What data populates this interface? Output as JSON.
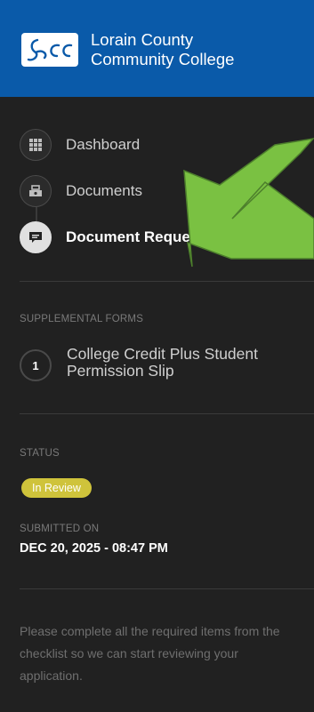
{
  "header": {
    "brand_line1": "Lorain County",
    "brand_line2": "Community College",
    "logo_text": "Lcc"
  },
  "nav": [
    {
      "label": "Dashboard",
      "icon": "grid-icon",
      "active": false
    },
    {
      "label": "Documents",
      "icon": "documents-icon",
      "active": false
    },
    {
      "label": "Document Request",
      "icon": "comment-icon",
      "active": true
    }
  ],
  "supplemental": {
    "title": "SUPPLEMENTAL FORMS",
    "items": [
      {
        "number": "1",
        "label": "College Credit Plus Student Permission Slip"
      }
    ]
  },
  "status": {
    "title": "STATUS",
    "badge": "In Review",
    "submitted_label": "SUBMITTED ON",
    "submitted_value": "DEC 20, 2025 - 08:47 PM"
  },
  "note": "Please complete all the required items from the checklist so we can start reviewing your application.",
  "colors": {
    "header": "#0a5aa9",
    "sidebar": "#212121",
    "badge": "#cfc33b",
    "arrow": "#7ac142"
  }
}
